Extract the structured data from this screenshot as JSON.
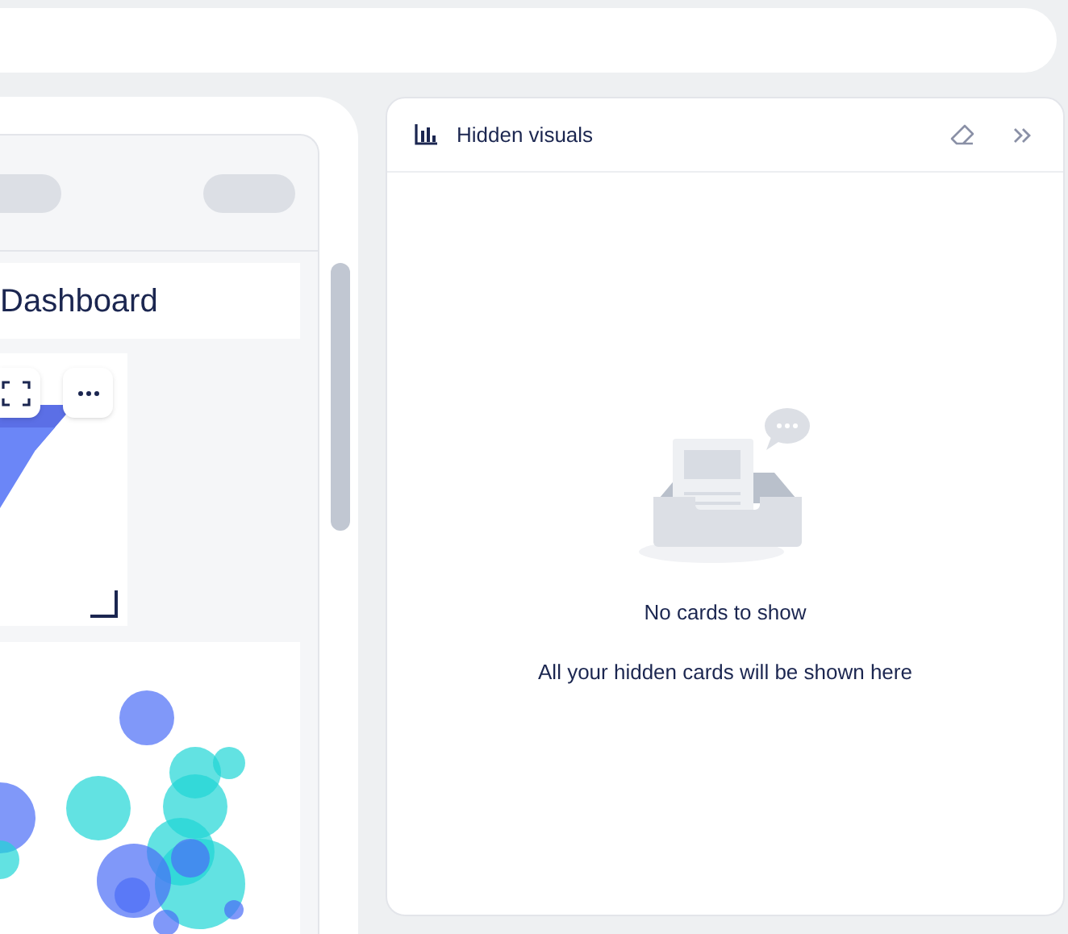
{
  "dashboard": {
    "title": "Dashboard"
  },
  "hidden_visuals_panel": {
    "title": "Hidden visuals",
    "empty_state": {
      "title": "No cards to show",
      "message": "All your hidden cards will be shown here"
    }
  }
}
